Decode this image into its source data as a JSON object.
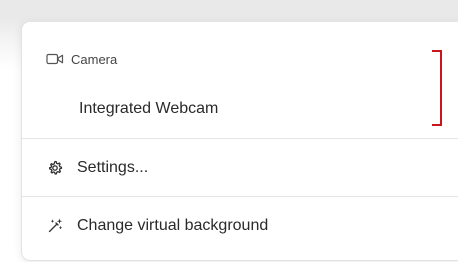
{
  "menu": {
    "camera_header": {
      "label": "Camera",
      "icon": "camera-icon"
    },
    "selected_device": "Integrated Webcam",
    "items": [
      {
        "label": "Settings...",
        "icon": "gear-icon"
      },
      {
        "label": "Change virtual background",
        "icon": "magic-wand-icon"
      }
    ]
  },
  "colors": {
    "highlight_bracket": "#c9161c",
    "text": "#2a2a2a",
    "muted_text": "#444444",
    "divider": "#e5e5e5"
  }
}
